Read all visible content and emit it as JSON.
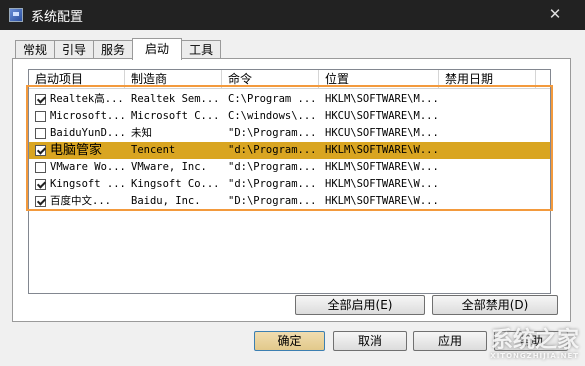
{
  "window": {
    "title": "系统配置",
    "close_glyph": "✕"
  },
  "tabs": [
    {
      "label": "常规"
    },
    {
      "label": "引导"
    },
    {
      "label": "服务"
    },
    {
      "label": "启动",
      "active": true
    },
    {
      "label": "工具"
    }
  ],
  "columns": [
    "启动项目",
    "制造商",
    "命令",
    "位置",
    "禁用日期"
  ],
  "rows": [
    {
      "checked": true,
      "name": "Realtek高...",
      "maker": "Realtek Sem...",
      "command": "C:\\Program ...",
      "location": "HKLM\\SOFTWARE\\M...",
      "disabled_date": ""
    },
    {
      "checked": false,
      "name": "Microsoft...",
      "maker": "Microsoft C...",
      "command": "C:\\windows\\...",
      "location": "HKCU\\SOFTWARE\\M...",
      "disabled_date": ""
    },
    {
      "checked": false,
      "name": "BaiduYunD...",
      "maker": "未知",
      "command": "\"D:\\Program...",
      "location": "HKCU\\SOFTWARE\\M...",
      "disabled_date": ""
    },
    {
      "checked": true,
      "name": "电脑管家",
      "maker": "Tencent",
      "command": "\"d:\\Program...",
      "location": "HKLM\\SOFTWARE\\W...",
      "disabled_date": "",
      "selected": true
    },
    {
      "checked": false,
      "name": "VMware Wo...",
      "maker": "VMware, Inc.",
      "command": "\"d:\\Program...",
      "location": "HKLM\\SOFTWARE\\W...",
      "disabled_date": ""
    },
    {
      "checked": true,
      "name": "Kingsoft ...",
      "maker": "Kingsoft Co...",
      "command": "\"d:\\Program...",
      "location": "HKLM\\SOFTWARE\\W...",
      "disabled_date": ""
    },
    {
      "checked": true,
      "name": "百度中文...",
      "maker": "Baidu, Inc.",
      "command": "\"D:\\Program...",
      "location": "HKLM\\SOFTWARE\\W...",
      "disabled_date": ""
    }
  ],
  "buttons": {
    "enable_all": "全部启用(E)",
    "disable_all": "全部禁用(D)",
    "ok": "确定",
    "cancel": "取消",
    "apply": "应用",
    "help": "帮助"
  },
  "watermark": {
    "text": "系统之家",
    "sub": "XITONGZHIJIA.NET"
  },
  "colors": {
    "selected_row": "#d9a521",
    "highlight_border": "#f39a3d",
    "titlebar": "#222222"
  }
}
